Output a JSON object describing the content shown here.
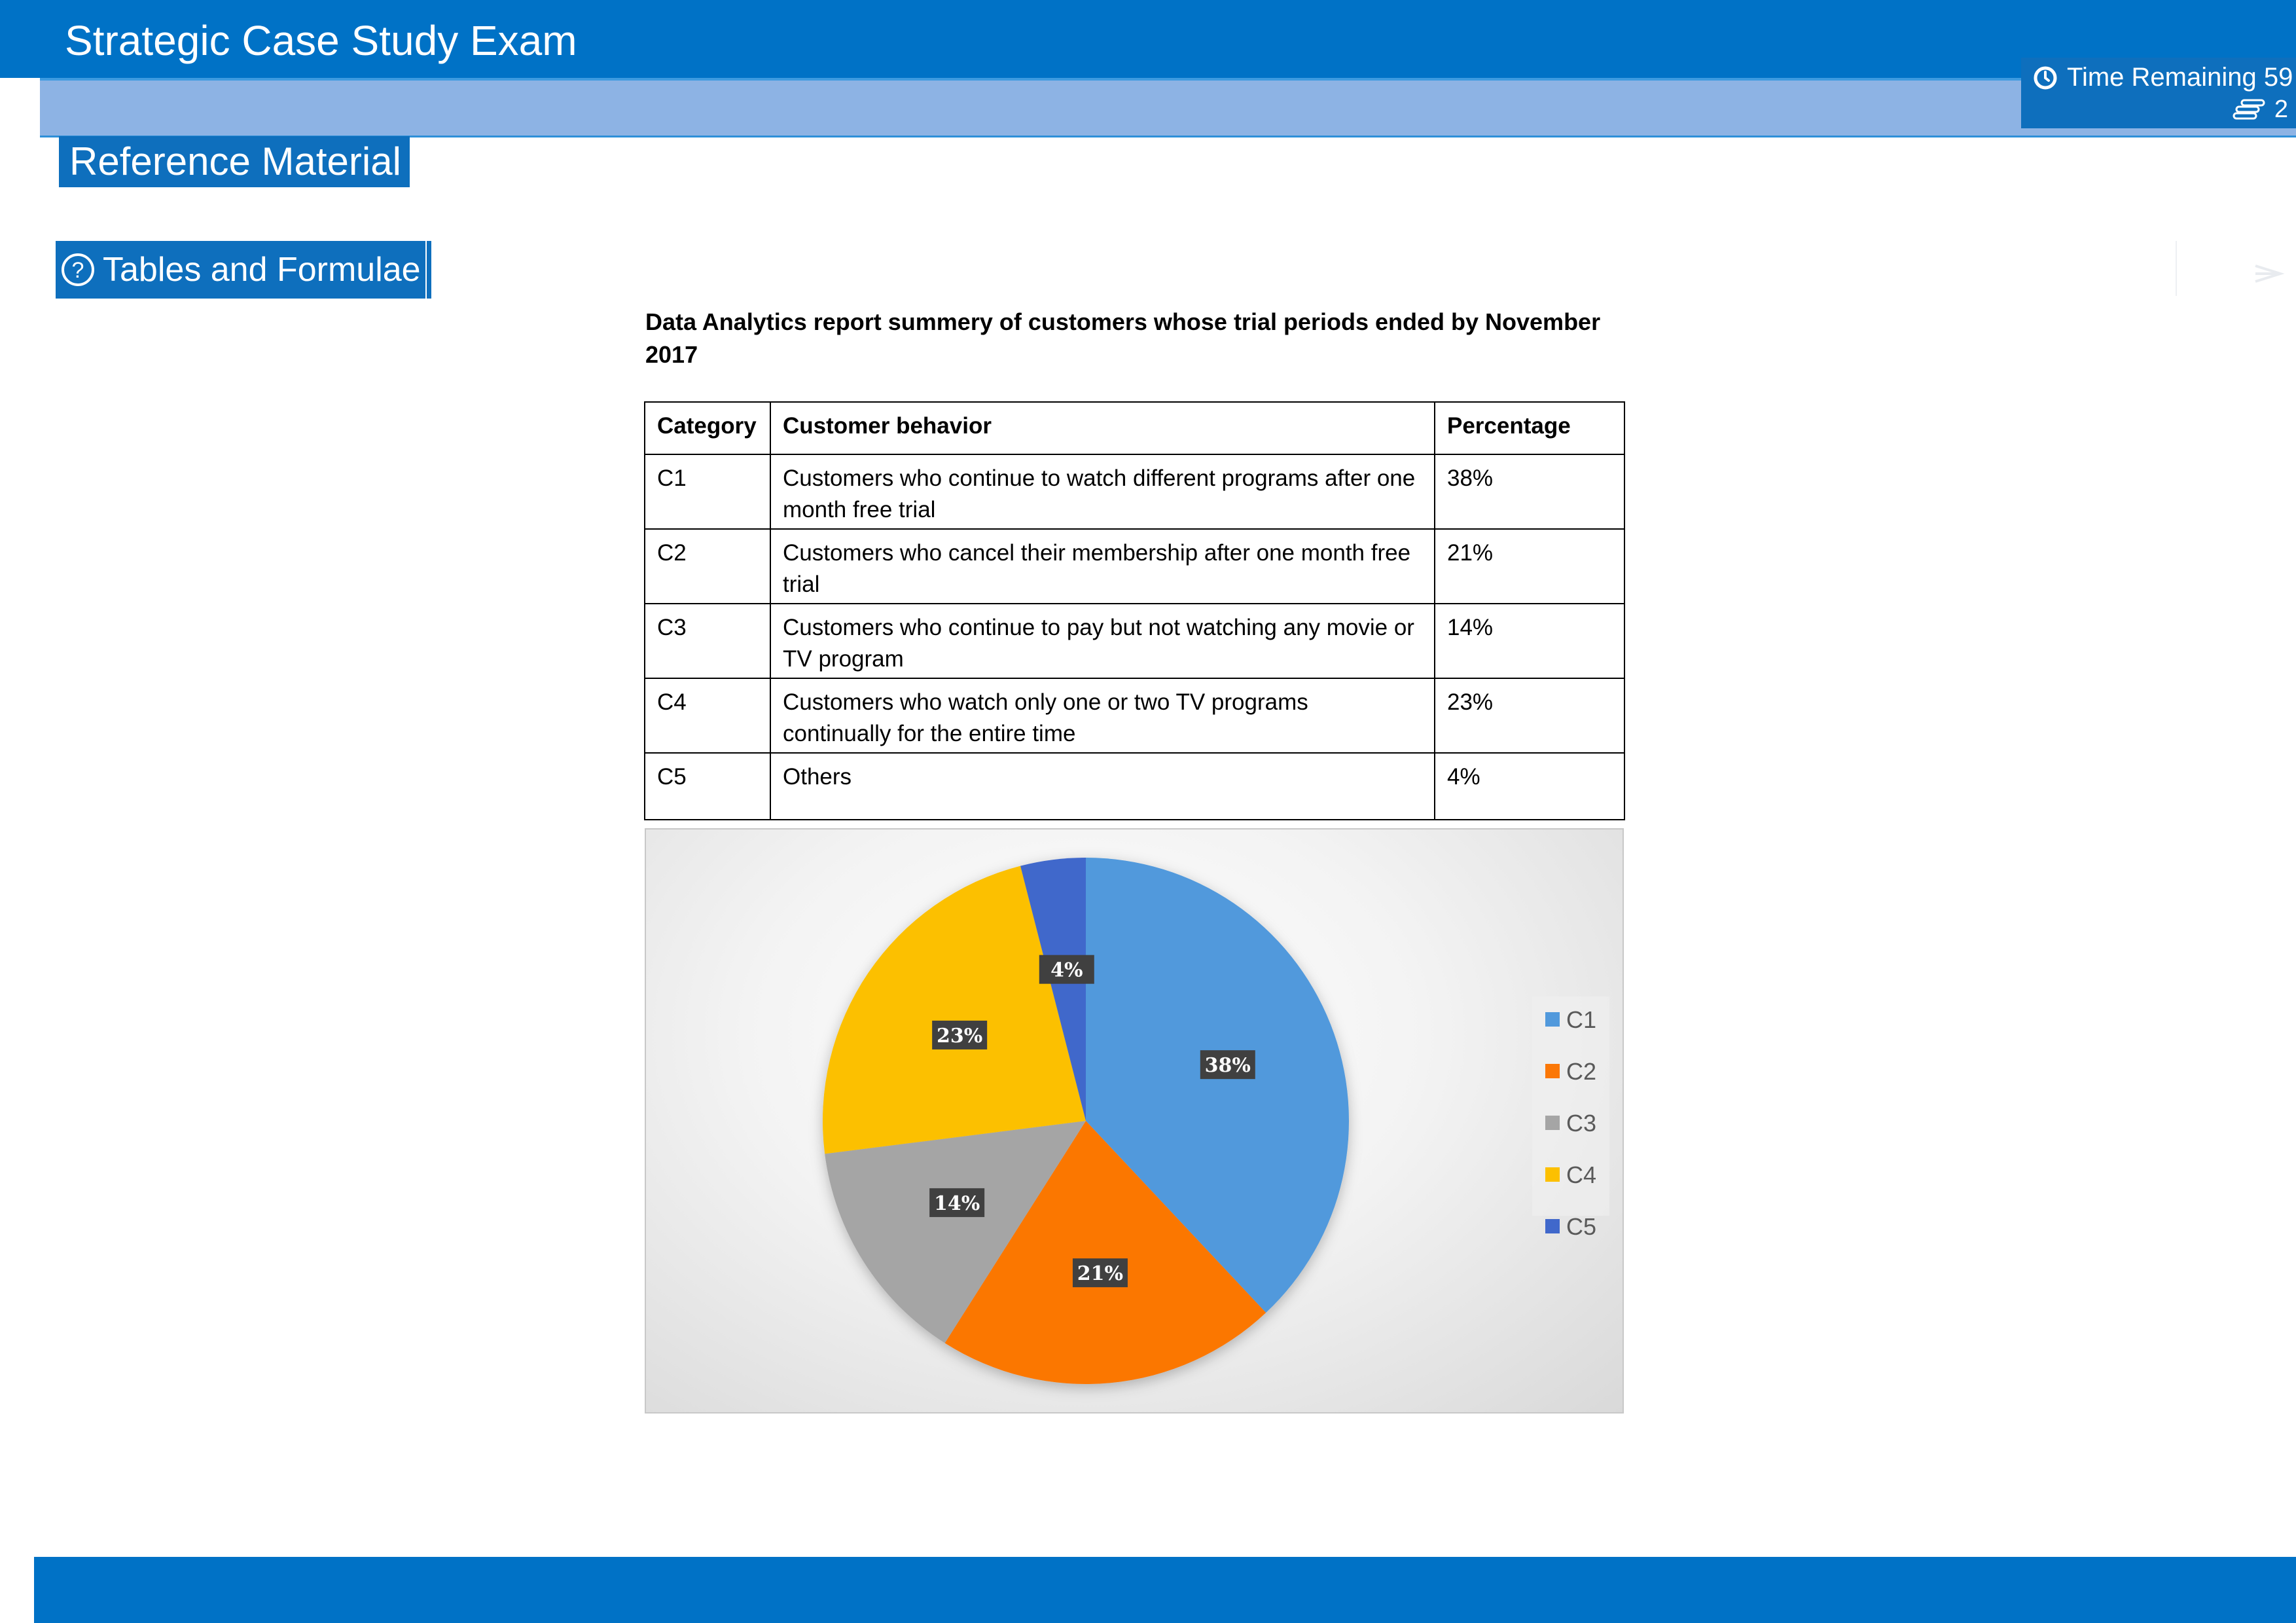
{
  "app": {
    "title": "Strategic Case Study Exam"
  },
  "timer": {
    "label": "Time Remaining 59",
    "page_count": "2"
  },
  "reference": {
    "header": "Reference Material",
    "tables_button": "Tables and Formulae"
  },
  "report": {
    "title": "Data Analytics report summery of customers whose trial periods ended by November 2017",
    "columns": [
      "Category",
      "Customer behavior",
      "Percentage"
    ],
    "rows": [
      {
        "category": "C1",
        "behavior": "Customers who continue to watch different programs after one month free trial",
        "percentage": "38%"
      },
      {
        "category": "C2",
        "behavior": "Customers who cancel their membership after one month free trial",
        "percentage": "21%"
      },
      {
        "category": "C3",
        "behavior": "Customers who continue to pay but not watching any movie or TV program",
        "percentage": "14%"
      },
      {
        "category": "C4",
        "behavior": "Customers who watch only one or two TV programs continually for the entire time",
        "percentage": "23%"
      },
      {
        "category": "C5",
        "behavior": "Others",
        "percentage": "4%"
      }
    ]
  },
  "chart_data": {
    "type": "pie",
    "categories": [
      "C1",
      "C2",
      "C3",
      "C4",
      "C5"
    ],
    "values": [
      38,
      21,
      14,
      23,
      4
    ],
    "labels": [
      "38%",
      "21%",
      "14%",
      "23%",
      "4%"
    ],
    "colors": [
      "#5199dc",
      "#fb7706",
      "#a5a5a5",
      "#fcc000",
      "#4068cb"
    ],
    "legend": "right",
    "title": ""
  },
  "colors": {
    "brand": "#0072c6",
    "subbar": "#8db3e4",
    "button": "#0e6fbd"
  }
}
